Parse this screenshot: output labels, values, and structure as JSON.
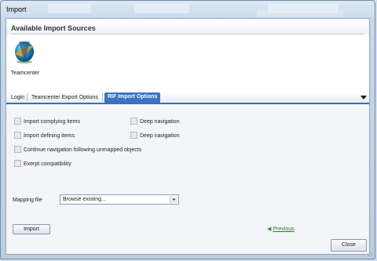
{
  "window": {
    "title": "Import"
  },
  "sources": {
    "header": "Available Import Sources",
    "items": [
      {
        "label": "Teamcenter",
        "icon": "teamcenter-logo-icon"
      }
    ]
  },
  "tabs": [
    {
      "label": "Login",
      "active": false
    },
    {
      "label": "Teamcenter Export Options",
      "active": false
    },
    {
      "label": "RIF Import Options",
      "active": true
    }
  ],
  "options": {
    "checkboxes": {
      "import_complying": {
        "label": "Import complying items",
        "checked": false,
        "enabled": false
      },
      "deep_nav_1": {
        "label": "Deep navigation",
        "checked": false,
        "enabled": false
      },
      "import_defining": {
        "label": "Import defining items",
        "checked": false,
        "enabled": false
      },
      "deep_nav_2": {
        "label": "Deep navigation",
        "checked": false,
        "enabled": false
      },
      "continue_nav": {
        "label": "Continue navigation following unmapped objects",
        "checked": false,
        "enabled": false
      },
      "exerpt": {
        "label": "Exerpt compatibility",
        "checked": false,
        "enabled": false
      }
    },
    "mapping_file": {
      "label": "Mapping file",
      "value": "Browse existing..."
    },
    "import_button": "Import",
    "previous_link": "Previous"
  },
  "close_button": "Close",
  "colors": {
    "accent": "#3a74c4",
    "link": "#2f7a2f"
  }
}
